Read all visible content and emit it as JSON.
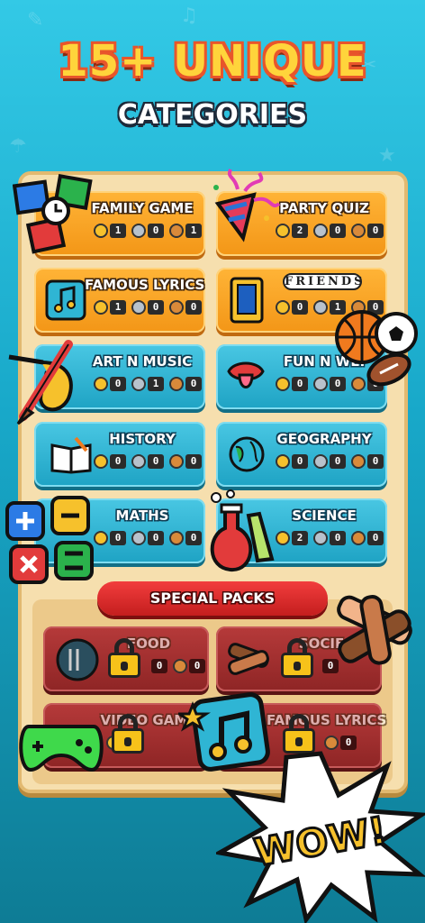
{
  "header": {
    "headline": "15+ UNIQUE",
    "subheadline": "CATEGORIES"
  },
  "categories": [
    {
      "name": "FAMILY GAME",
      "gold": "1",
      "silver": "0",
      "bronze": "1",
      "color": "orange",
      "icon": "family-game-icon"
    },
    {
      "name": "PARTY QUIZ",
      "gold": "2",
      "silver": "0",
      "bronze": "0",
      "color": "orange",
      "icon": "party-popper-icon"
    },
    {
      "name": "FAMOUS LYRICS",
      "gold": "1",
      "silver": "0",
      "bronze": "0",
      "color": "orange",
      "icon": "music-note-icon"
    },
    {
      "name": "FRIENDS",
      "gold": "0",
      "silver": "1",
      "bronze": "0",
      "color": "orange",
      "icon": "door-frame-icon"
    },
    {
      "name": "ART N MUSIC",
      "gold": "0",
      "silver": "1",
      "bronze": "0",
      "color": "blue",
      "icon": "brush-saxophone-icon"
    },
    {
      "name": "FUN N WEI",
      "gold": "0",
      "silver": "0",
      "bronze": "0",
      "color": "blue",
      "icon": "lips-tongue-icon"
    },
    {
      "name": "HISTORY",
      "gold": "0",
      "silver": "0",
      "bronze": "0",
      "color": "blue",
      "icon": "book-quill-icon"
    },
    {
      "name": "GEOGRAPHY",
      "gold": "0",
      "silver": "0",
      "bronze": "0",
      "color": "blue",
      "icon": "globe-icon"
    },
    {
      "name": "MATHS",
      "gold": "0",
      "silver": "0",
      "bronze": "0",
      "color": "blue",
      "icon": "calculator-keys-icon"
    },
    {
      "name": "SCIENCE",
      "gold": "2",
      "silver": "0",
      "bronze": "0",
      "color": "blue",
      "icon": "flask-icon"
    }
  ],
  "special": {
    "button_label": "SPECIAL PACKS",
    "packs": [
      {
        "name": "FOOD",
        "gold": "",
        "silver": "0",
        "bronze": "0",
        "locked": true,
        "icon": "fork-knife-icon"
      },
      {
        "name": "SOCIE",
        "gold": "",
        "silver": "0",
        "bronze": "",
        "locked": true,
        "icon": "hands-stack-icon"
      },
      {
        "name": "VIDEO GAME",
        "gold": "0",
        "silver": "",
        "bronze": "",
        "locked": true,
        "icon": "gamepad-icon"
      },
      {
        "name": "FAMOUS LYRICS",
        "gold": "",
        "silver": "",
        "bronze": "0",
        "locked": true,
        "icon": "music-note-icon"
      }
    ]
  },
  "badge": {
    "text": "WOW!"
  },
  "colors": {
    "gold": "#f6c12c",
    "silver": "#b8c2cc",
    "bronze": "#d98a3a",
    "orange": "#f7a024",
    "blue": "#2fb5d4",
    "red": "#a12f2f"
  }
}
